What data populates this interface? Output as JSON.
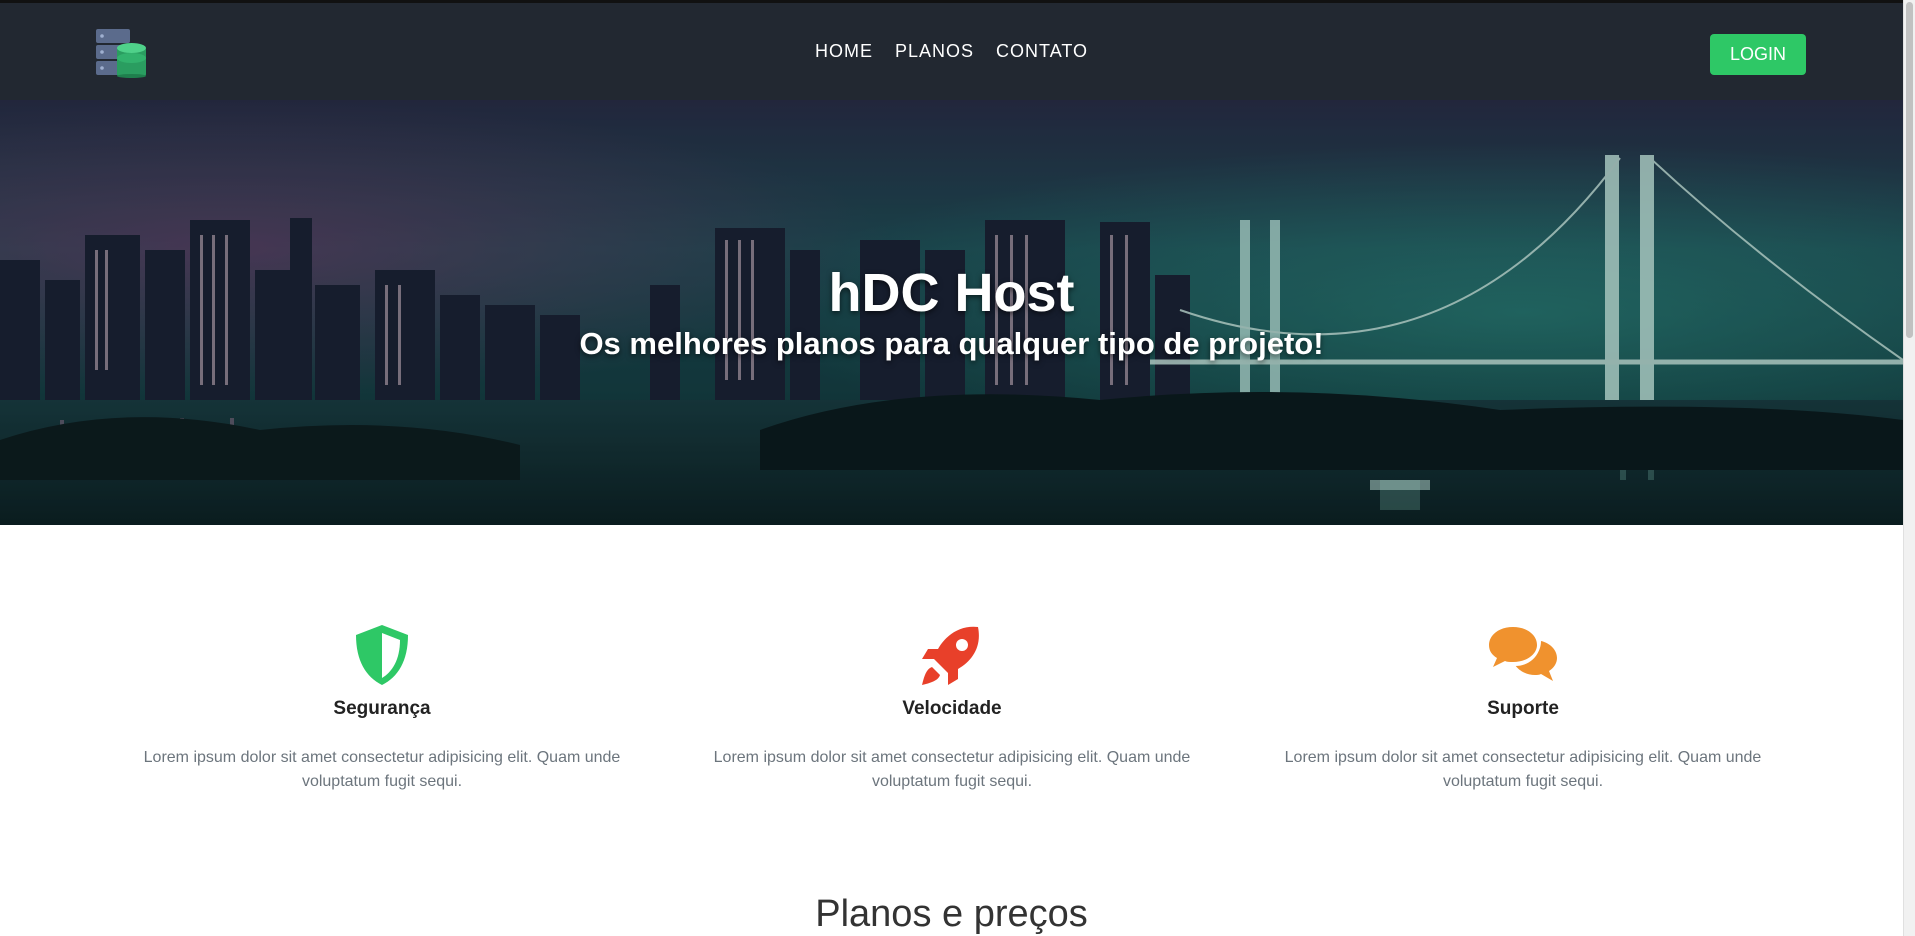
{
  "navbar": {
    "logo_icon": "server-database-icon",
    "links": [
      {
        "label": "HOME"
      },
      {
        "label": "PLANOS"
      },
      {
        "label": "CONTATO"
      }
    ],
    "login_label": "LOGIN",
    "background": "#222831",
    "accent": "#2ec866"
  },
  "hero": {
    "title": "hDC Host",
    "subtitle": "Os melhores planos para qualquer tipo de projeto!"
  },
  "features": [
    {
      "icon": "shield-icon",
      "color": "#2ec866",
      "title": "Segurança",
      "text": "Lorem ipsum dolor sit amet consectetur adipisicing elit. Quam unde voluptatum fugit sequi."
    },
    {
      "icon": "rocket-icon",
      "color": "#e8402a",
      "title": "Velocidade",
      "text": "Lorem ipsum dolor sit amet consectetur adipisicing elit. Quam unde voluptatum fugit sequi."
    },
    {
      "icon": "chat-bubbles-icon",
      "color": "#f0922e",
      "title": "Suporte",
      "text": "Lorem ipsum dolor sit amet consectetur adipisicing elit. Quam unde voluptatum fugit sequi."
    }
  ],
  "plans_section": {
    "title": "Planos e preços"
  }
}
